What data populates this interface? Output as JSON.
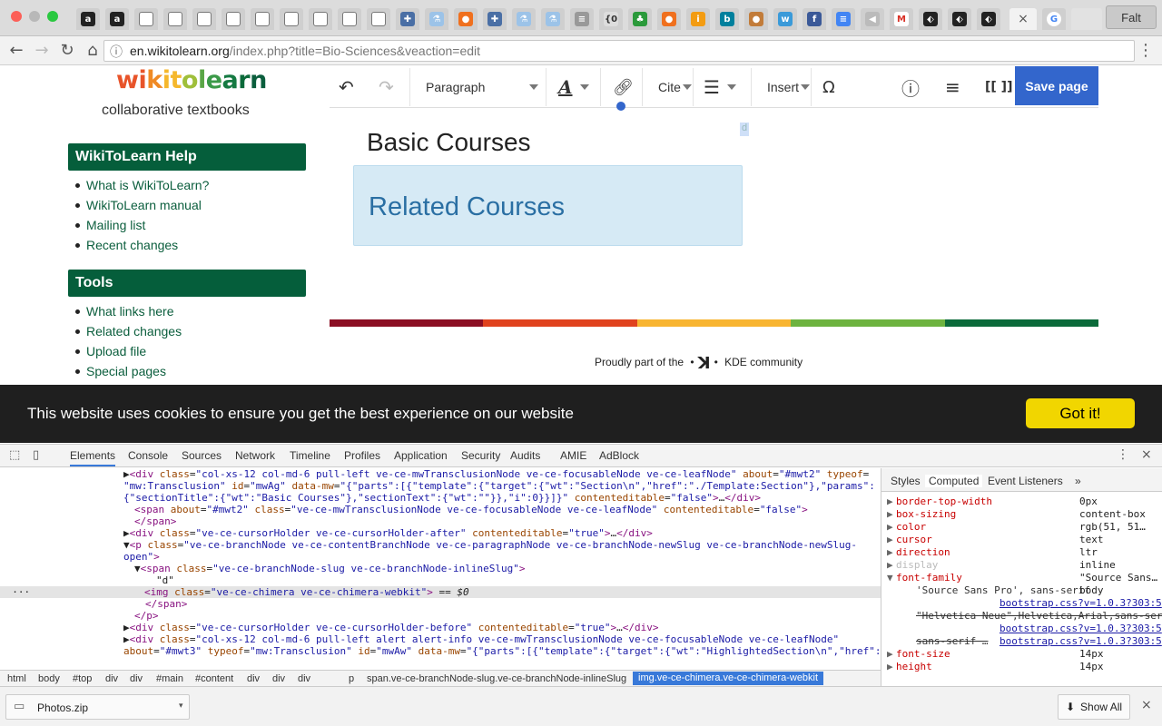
{
  "browser": {
    "address": {
      "host": "en.wikitolearn.org",
      "path": "/index.php?title=Bio-Sciences&veaction=edit"
    },
    "user_label": "Falt"
  },
  "site": {
    "logo_parts": [
      {
        "t": "w",
        "c": "#e8542a"
      },
      {
        "t": "i",
        "c": "#e8542a"
      },
      {
        "t": "k",
        "c": "#f08a24"
      },
      {
        "t": "i",
        "c": "#f5b72c"
      },
      {
        "t": "t",
        "c": "#f5b72c"
      },
      {
        "t": "o",
        "c": "#9fbf3a"
      },
      {
        "t": "l",
        "c": "#5aa646"
      },
      {
        "t": "e",
        "c": "#3b9a48"
      },
      {
        "t": "a",
        "c": "#157a42"
      },
      {
        "t": "r",
        "c": "#0b6a3a"
      },
      {
        "t": "n",
        "c": "#0b5e3d"
      }
    ],
    "tagline": "collaborative textbooks",
    "help_title": "WikiToLearn Help",
    "help_links": [
      "What is WikiToLearn?",
      "WikiToLearn manual",
      "Mailing list",
      "Recent changes"
    ],
    "tools_title": "Tools",
    "tools_links": [
      "What links here",
      "Related changes",
      "Upload file",
      "Special pages"
    ]
  },
  "editor": {
    "paragraph": "Paragraph",
    "cite": "Cite",
    "insert": "Insert",
    "omega": "Ω",
    "wikitext": "[[ ]]",
    "save": "Save page",
    "heading": "Basic Courses",
    "related": "Related Courses",
    "cursor_char": "d"
  },
  "footer": {
    "proudly": "Proudly part of the",
    "community": "KDE community",
    "bar_colors": [
      "#8b0e23",
      "#e0421e",
      "#f8b531",
      "#6db33f",
      "#0b6a3a"
    ]
  },
  "cookie": {
    "text": "This website uses cookies to ensure you get the best experience on our website",
    "button": "Got it!"
  },
  "devtools": {
    "tabs": [
      "Elements",
      "Console",
      "Sources",
      "Network",
      "Timeline",
      "Profiles",
      "Application",
      "Security",
      "Audits",
      "AMIE",
      "AdBlock"
    ],
    "side_tabs": [
      "Styles",
      "Computed",
      "Event Listeners",
      "»"
    ],
    "breadcrumbs": [
      "html",
      "body",
      "#top",
      "div",
      "div",
      "#main",
      "#content",
      "div",
      "div",
      "div",
      "p",
      "span.ve-ce-branchNode-slug.ve-ce-branchNode-inlineSlug",
      "img.ve-ce-chimera.ve-ce-chimera-webkit"
    ],
    "computed": [
      {
        "k": "border-top-width",
        "v": "0px"
      },
      {
        "k": "box-sizing",
        "v": "content-box"
      },
      {
        "k": "color",
        "v": "rgb(51, 51…"
      },
      {
        "k": "cursor",
        "v": "text"
      },
      {
        "k": "direction",
        "v": "ltr"
      },
      {
        "k": "display",
        "v": "inline"
      },
      {
        "k": "font-family",
        "v": "\"Source Sans…"
      },
      {
        "k": "'Source Sans Pro', sans-serif",
        "v": "body"
      },
      {
        "k": "",
        "v": "bootstrap.css?v=1.0.3?303:5"
      },
      {
        "k": "\"Helvetica Neue\",Helvetica,Arial,sans-serif",
        "v": ""
      },
      {
        "k": "",
        "v": "bootstrap.css?v=1.0.3?303:5"
      },
      {
        "k": "sans-serif …",
        "v": "bootstrap.css?v=1.0.3?303:5"
      },
      {
        "k": "font-size",
        "v": "14px"
      },
      {
        "k": "height",
        "v": "14px"
      }
    ]
  },
  "downloads": {
    "file": "Photos.zip",
    "show_all": "Show All"
  }
}
